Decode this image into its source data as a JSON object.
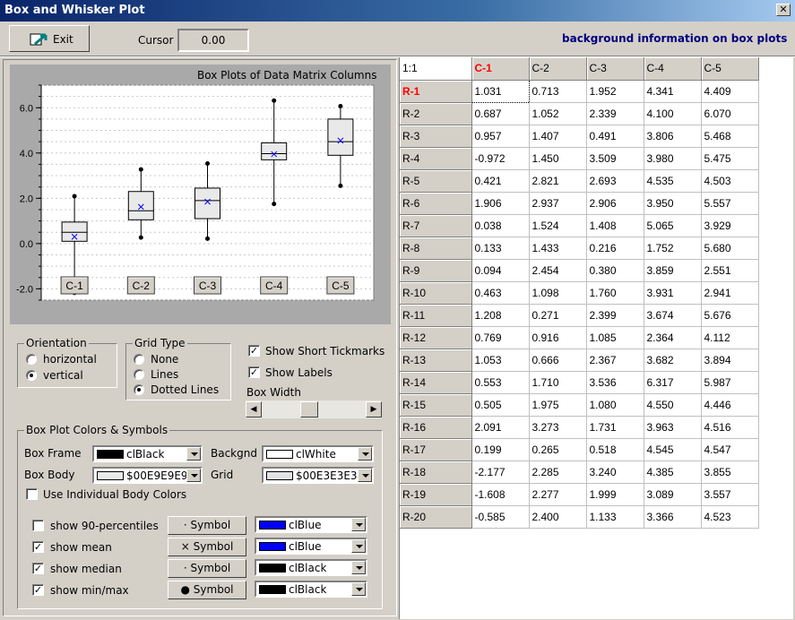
{
  "window": {
    "title": "Box and Whisker Plot",
    "close_glyph": "✕"
  },
  "toolbar": {
    "exit_label": "Exit",
    "cursor_label": "Cursor",
    "cursor_value": "0.00",
    "info_link": "background information on box plots"
  },
  "chart_data": {
    "type": "box",
    "title": "Box Plots of Data Matrix Columns",
    "categories": [
      "C-1",
      "C-2",
      "C-3",
      "C-4",
      "C-5"
    ],
    "ylim": [
      -2.5,
      7.0
    ],
    "yticks": [
      -2.0,
      0.0,
      2.0,
      4.0,
      6.0
    ],
    "ytick_labels": [
      "-2.0",
      "0.0",
      "2.0",
      "4.0",
      "6.0"
    ],
    "grid": "dotted",
    "boxes": [
      {
        "min": -2.177,
        "q1": 0.1,
        "median": 0.5,
        "q3": 0.95,
        "max": 2.091,
        "mean": 0.3
      },
      {
        "min": 0.265,
        "q1": 1.05,
        "median": 1.45,
        "q3": 2.3,
        "max": 3.273,
        "mean": 1.62
      },
      {
        "min": 0.216,
        "q1": 1.1,
        "median": 1.9,
        "q3": 2.45,
        "max": 3.536,
        "mean": 1.85
      },
      {
        "min": 1.752,
        "q1": 3.7,
        "median": 3.97,
        "q3": 4.45,
        "max": 6.317,
        "mean": 3.95
      },
      {
        "min": 2.551,
        "q1": 3.9,
        "median": 4.5,
        "q3": 5.5,
        "max": 6.07,
        "mean": 4.55
      }
    ],
    "colors": {
      "frame": "#000000",
      "body": "#e9e9e9",
      "background": "#ffffff",
      "grid": "#e3e3e3",
      "mean": "#0000ff",
      "median": "#000000",
      "minmax": "#000000"
    }
  },
  "orientation": {
    "title": "Orientation",
    "options": [
      "horizontal",
      "vertical"
    ],
    "selected": "vertical"
  },
  "grid_type": {
    "title": "Grid Type",
    "options": [
      "None",
      "Lines",
      "Dotted Lines"
    ],
    "selected": "Dotted Lines"
  },
  "options": {
    "short_tickmarks": {
      "label": "Show Short Tickmarks",
      "checked": true
    },
    "show_labels": {
      "label": "Show Labels",
      "checked": true
    },
    "box_width_label": "Box Width",
    "box_width_value": 0.45
  },
  "colors_group": {
    "title": "Box Plot Colors & Symbols",
    "box_frame": {
      "label": "Box Frame",
      "value": "clBlack",
      "swatch": "#000000"
    },
    "backgnd": {
      "label": "Backgnd",
      "value": "clWhite",
      "swatch": "#ffffff"
    },
    "box_body": {
      "label": "Box Body",
      "value": "$00E9E9E9",
      "swatch": "#e9e9e9"
    },
    "grid": {
      "label": "Grid",
      "value": "$00E3E3E3",
      "swatch": "#e3e3e3"
    },
    "individual": {
      "label": "Use Individual Body Colors",
      "checked": false
    },
    "rows": [
      {
        "label": "show 90-percentiles",
        "checked": false,
        "symbol_glyph": "·",
        "symbol_label": "Symbol",
        "color": "clBlue",
        "swatch": "#0000ff"
      },
      {
        "label": "show mean",
        "checked": true,
        "symbol_glyph": "×",
        "symbol_label": "Symbol",
        "color": "clBlue",
        "swatch": "#0000ff"
      },
      {
        "label": "show median",
        "checked": true,
        "symbol_glyph": "·",
        "symbol_label": "Symbol",
        "color": "clBlack",
        "swatch": "#000000"
      },
      {
        "label": "show min/max",
        "checked": true,
        "symbol_glyph": "●",
        "symbol_label": "Symbol",
        "color": "clBlack",
        "swatch": "#000000"
      }
    ]
  },
  "matrix": {
    "corner": "1:1",
    "columns": [
      "C-1",
      "C-2",
      "C-3",
      "C-4",
      "C-5"
    ],
    "active_col": "C-1",
    "active_row": "R-1",
    "rows": [
      {
        "name": "R-1",
        "values": [
          "1.031",
          "0.713",
          "1.952",
          "4.341",
          "4.409"
        ]
      },
      {
        "name": "R-2",
        "values": [
          "0.687",
          "1.052",
          "2.339",
          "4.100",
          "6.070"
        ]
      },
      {
        "name": "R-3",
        "values": [
          "0.957",
          "1.407",
          "0.491",
          "3.806",
          "5.468"
        ]
      },
      {
        "name": "R-4",
        "values": [
          "-0.972",
          "1.450",
          "3.509",
          "3.980",
          "5.475"
        ]
      },
      {
        "name": "R-5",
        "values": [
          "0.421",
          "2.821",
          "2.693",
          "4.535",
          "4.503"
        ]
      },
      {
        "name": "R-6",
        "values": [
          "1.906",
          "2.937",
          "2.906",
          "3.950",
          "5.557"
        ]
      },
      {
        "name": "R-7",
        "values": [
          "0.038",
          "1.524",
          "1.408",
          "5.065",
          "3.929"
        ]
      },
      {
        "name": "R-8",
        "values": [
          "0.133",
          "1.433",
          "0.216",
          "1.752",
          "5.680"
        ]
      },
      {
        "name": "R-9",
        "values": [
          "0.094",
          "2.454",
          "0.380",
          "3.859",
          "2.551"
        ]
      },
      {
        "name": "R-10",
        "values": [
          "0.463",
          "1.098",
          "1.760",
          "3.931",
          "2.941"
        ]
      },
      {
        "name": "R-11",
        "values": [
          "1.208",
          "0.271",
          "2.399",
          "3.674",
          "5.676"
        ]
      },
      {
        "name": "R-12",
        "values": [
          "0.769",
          "0.916",
          "1.085",
          "2.364",
          "4.112"
        ]
      },
      {
        "name": "R-13",
        "values": [
          "1.053",
          "0.666",
          "2.367",
          "3.682",
          "3.894"
        ]
      },
      {
        "name": "R-14",
        "values": [
          "0.553",
          "1.710",
          "3.536",
          "6.317",
          "5.987"
        ]
      },
      {
        "name": "R-15",
        "values": [
          "0.505",
          "1.975",
          "1.080",
          "4.550",
          "4.446"
        ]
      },
      {
        "name": "R-16",
        "values": [
          "2.091",
          "3.273",
          "1.731",
          "3.963",
          "4.516"
        ]
      },
      {
        "name": "R-17",
        "values": [
          "0.199",
          "0.265",
          "0.518",
          "4.545",
          "4.547"
        ]
      },
      {
        "name": "R-18",
        "values": [
          "-2.177",
          "2.285",
          "3.240",
          "4.385",
          "3.855"
        ]
      },
      {
        "name": "R-19",
        "values": [
          "-1.608",
          "2.277",
          "1.999",
          "3.089",
          "3.557"
        ]
      },
      {
        "name": "R-20",
        "values": [
          "-0.585",
          "2.400",
          "1.133",
          "3.366",
          "4.523"
        ]
      }
    ]
  }
}
